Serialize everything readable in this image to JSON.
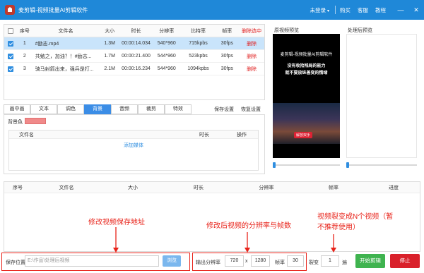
{
  "titlebar": {
    "title": "麦剪辑-视频批量AI剪辑软件",
    "login": "未登录",
    "links": [
      "购买",
      "客服",
      "教程"
    ],
    "minimize": "—",
    "close": "✕"
  },
  "file_table": {
    "headers": {
      "no": "序号",
      "name": "文件名",
      "size": "大小",
      "duration": "时长",
      "resolution": "分辨率",
      "bitrate": "比特率",
      "fps": "帧率",
      "delete_selected": "删除选中"
    },
    "rows": [
      {
        "checked": true,
        "no": "1",
        "name": "#励志.mp4",
        "size": "1.3M",
        "duration": "00:00:14.034",
        "resolution": "540*960",
        "bitrate": "715kpbs",
        "fps": "30fps",
        "action": "删除"
      },
      {
        "checked": true,
        "no": "2",
        "name": "共勉之，加油？！#励志...",
        "size": "1.7M",
        "duration": "00:00:21.400",
        "resolution": "544*960",
        "bitrate": "523kpbs",
        "fps": "30fps",
        "action": "删除"
      },
      {
        "checked": true,
        "no": "3",
        "name": "骑马射箭出来，强兵是打...",
        "size": "2.1M",
        "duration": "00:00:16.234",
        "resolution": "544*960",
        "bitrate": "1094kpbs",
        "fps": "30fps",
        "action": "删除"
      }
    ]
  },
  "preview": {
    "original_label": "原视频预览",
    "processed_label": "处理后预览",
    "video_title": "麦剪辑-视频批量AI剪辑软件",
    "video_line1": "没有收拾残局的能力",
    "video_line2": "就不要放纵善变的情绪",
    "video_badge": "解放双手",
    "original_progress": 0,
    "processed_progress": 0
  },
  "tabs": {
    "items": [
      "画中画",
      "文本",
      "调色",
      "背景",
      "音频",
      "裁剪",
      "特效"
    ],
    "active": "背景",
    "save_settings": "保存设置",
    "restore_settings": "恢复设置"
  },
  "background_panel": {
    "label": "背景色",
    "color": "#f08a8a",
    "headers": {
      "name": "文件名",
      "duration": "时长",
      "operation": "操作"
    },
    "add_media": "添加媒体"
  },
  "task_table": {
    "headers": [
      "序号",
      "文件名",
      "大小",
      "时长",
      "分辨率",
      "帧率",
      "进度"
    ]
  },
  "annotations": {
    "save_path": "修改视频保存地址",
    "res_fps": "修改后视频的分辨率与帧数",
    "split_line1": "视频裂变成N个视频（暂",
    "split_line2": "不推荐使用）"
  },
  "bottom": {
    "save_label": "保存位置",
    "save_path": "E:\\作品\\处理后视频",
    "browse": "浏览",
    "res_label": "输出分辨率",
    "width": "720",
    "x": "x",
    "height": "1280",
    "fps_label": "帧率",
    "fps": "30",
    "split_label": "裂变",
    "split_count": "1",
    "split_unit": "遍",
    "start": "开始剪辑",
    "stop": "停止"
  },
  "colors": {
    "titlebar": "#1f88d8",
    "accent": "#3b8de6",
    "annotation": "#e8231a",
    "start": "#3fb34f",
    "stop": "#d9212b"
  }
}
